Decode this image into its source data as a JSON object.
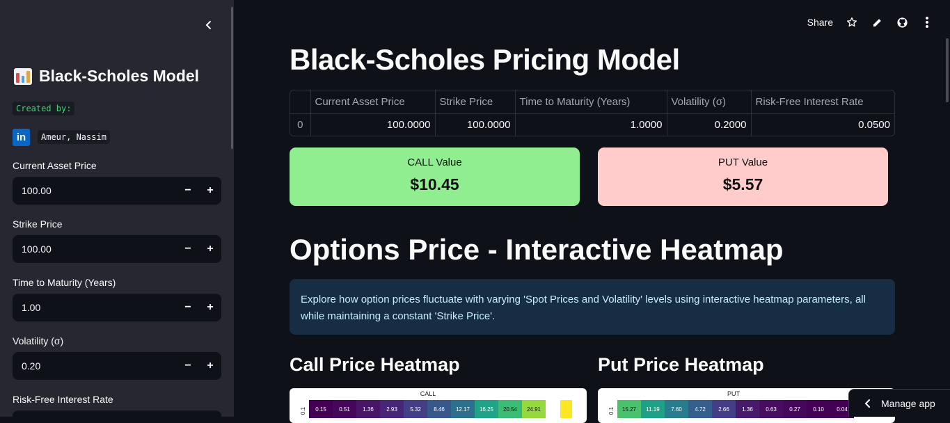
{
  "sidebar": {
    "title": "Black-Scholes Model",
    "created_by": "Created by:",
    "author": "Ameur, Nassim",
    "linkedin_text": "in",
    "fields": [
      {
        "label": "Current Asset Price",
        "value": "100.00"
      },
      {
        "label": "Strike Price",
        "value": "100.00"
      },
      {
        "label": "Time to Maturity (Years)",
        "value": "1.00"
      },
      {
        "label": "Volatility (σ)",
        "value": "0.20"
      },
      {
        "label": "Risk-Free Interest Rate",
        "value": ""
      }
    ],
    "minus": "−",
    "plus": "+",
    "collapse_icon": "chevron-left"
  },
  "toolbar": {
    "share": "Share",
    "icons": [
      "star-icon",
      "edit-icon",
      "github-icon",
      "more-icon"
    ]
  },
  "main": {
    "title": "Black-Scholes Pricing Model",
    "table": {
      "headers": [
        "",
        "Current Asset Price",
        "Strike Price",
        "Time to Maturity (Years)",
        "Volatility (σ)",
        "Risk-Free Interest Rate"
      ],
      "row": [
        "0",
        "100.0000",
        "100.0000",
        "1.0000",
        "0.2000",
        "0.0500"
      ]
    },
    "call": {
      "label": "CALL Value",
      "value": "$10.45",
      "color": "#90ee90"
    },
    "put": {
      "label": "PUT Value",
      "value": "$5.57",
      "color": "#ffcccb"
    },
    "section_title": "Options Price - Interactive Heatmap",
    "info_text": "Explore how option prices fluctuate with varying 'Spot Prices and Volatility' levels using interactive heatmap parameters, all while maintaining a constant 'Strike Price'.",
    "call_heatmap": {
      "heading": "Call Price Heatmap",
      "chart_title": "CALL",
      "ylabel": "0.1",
      "values": [
        "0.15",
        "0.51",
        "1.36",
        "2.93",
        "5.32",
        "8.46",
        "12.17",
        "16.25",
        "20.54",
        "24.91"
      ],
      "colors": [
        "#440154",
        "#46075a",
        "#481567",
        "#482677",
        "#433e85",
        "#38588c",
        "#2d708e",
        "#20a386",
        "#3cbb75",
        "#95d840"
      ]
    },
    "put_heatmap": {
      "heading": "Put Price Heatmap",
      "chart_title": "PUT",
      "ylabel": "0.1",
      "values": [
        "15.27",
        "11.19",
        "7.60",
        "4.72",
        "2.66",
        "1.36",
        "0.63",
        "0.27",
        "0.10",
        "0.04"
      ],
      "colors": [
        "#4ac16d",
        "#1fa088",
        "#287c8e",
        "#355e8d",
        "#433e85",
        "#481a6c",
        "#470d60",
        "#45075a",
        "#440256",
        "#440154"
      ]
    }
  },
  "manage_app": "Manage app"
}
